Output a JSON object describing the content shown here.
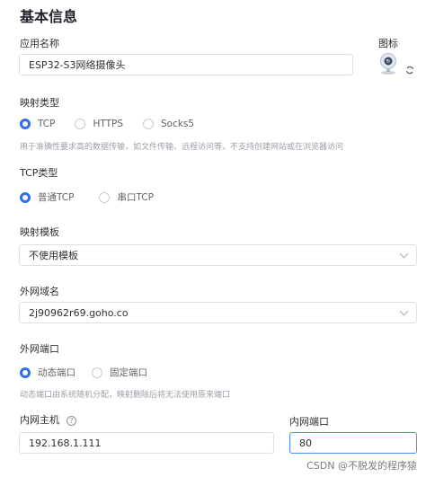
{
  "form": {
    "title": "基本信息",
    "app_name": {
      "label": "应用名称",
      "value": "ESP32-S3网络摄像头"
    },
    "icon": {
      "label": "图标",
      "icon_name": "webcam-icon",
      "refresh_icon": "refresh-icon"
    },
    "mapping_type": {
      "label": "映射类型",
      "options": [
        "TCP",
        "HTTPS",
        "Socks5"
      ],
      "selected": "TCP",
      "hint": "用于准确性要求高的数据传输，如文件传输、远程访问等，不支持创建网站或在浏览器访问"
    },
    "tcp_type": {
      "label": "TCP类型",
      "options": [
        "普通TCP",
        "串口TCP"
      ],
      "selected": "普通TCP"
    },
    "template": {
      "label": "映射模板",
      "value": "不使用模板"
    },
    "domain": {
      "label": "外网域名",
      "value": "2j90962r69.goho.co"
    },
    "public_port": {
      "label": "外网端口",
      "options": [
        "动态端口",
        "固定端口"
      ],
      "selected": "动态端口",
      "hint": "动态端口由系统随机分配，映射删除后将无法使用原来端口"
    },
    "host": {
      "label": "内网主机",
      "help": "?",
      "value": "192.168.1.111"
    },
    "port": {
      "label": "内网端口",
      "value": "80"
    }
  },
  "watermark": "CSDN @不脱发的程序猿",
  "colors": {
    "accent": "#2f6fed",
    "border": "#dcdfe6",
    "focus_border": "#4d8ef7"
  }
}
